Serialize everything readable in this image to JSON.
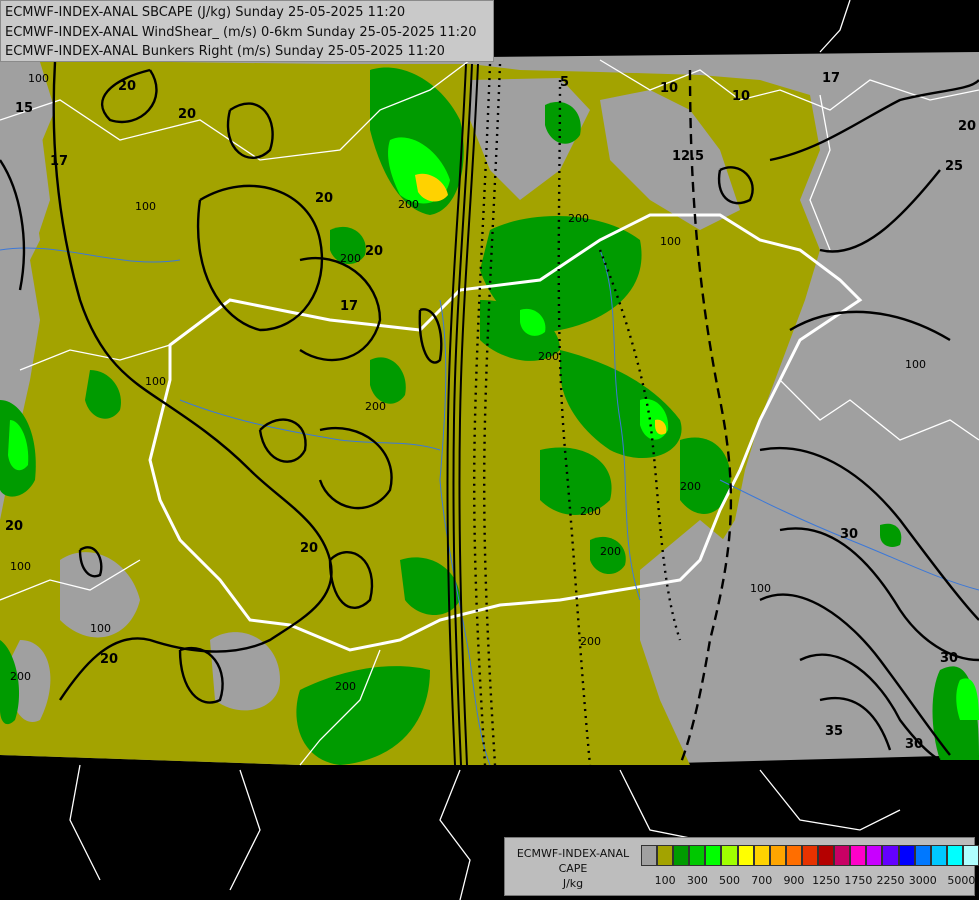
{
  "header": {
    "lines": [
      "ECMWF-INDEX-ANAL SBCAPE (J/kg) Sunday 25-05-2025 11:20",
      "ECMWF-INDEX-ANAL WindShear_ (m/s) 0-6km Sunday 25-05-2025 11:20",
      "ECMWF-INDEX-ANAL Bunkers Right (m/s) Sunday 25-05-2025 11:20"
    ]
  },
  "legend": {
    "title_line1": "ECMWF-INDEX-ANAL",
    "title_line2": "CAPE",
    "unit": "J/kg",
    "colors": [
      "#a0a0a0",
      "#a3a300",
      "#009b00",
      "#00c800",
      "#00ff00",
      "#a0ff00",
      "#ffff00",
      "#ffd200",
      "#ffa500",
      "#ff6e00",
      "#e63200",
      "#b40000",
      "#c80064",
      "#ff00c8",
      "#c800ff",
      "#6400ff",
      "#0000ff",
      "#0078ff",
      "#00c8ff",
      "#00ffff",
      "#afffff",
      "#ffffff"
    ],
    "tick_labels": [
      "100",
      "300",
      "500",
      "700",
      "900",
      "1250",
      "1750",
      "2250",
      "3000",
      "5000"
    ]
  },
  "map": {
    "contour_labels": [
      {
        "text": "20"
      },
      {
        "text": "20"
      },
      {
        "text": "20"
      },
      {
        "text": "17"
      },
      {
        "text": "20"
      },
      {
        "text": "20"
      },
      {
        "text": "17"
      },
      {
        "text": "15"
      },
      {
        "text": "17"
      },
      {
        "text": "20"
      },
      {
        "text": "25"
      },
      {
        "text": "30"
      },
      {
        "text": "30"
      },
      {
        "text": "35"
      },
      {
        "text": "30"
      },
      {
        "text": "20"
      },
      {
        "text": "20"
      },
      {
        "text": "10"
      },
      {
        "text": "12.5"
      },
      {
        "text": "10"
      },
      {
        "text": "5"
      },
      {
        "text": "100"
      },
      {
        "text": "100"
      },
      {
        "text": "200"
      },
      {
        "text": "200"
      },
      {
        "text": "200"
      },
      {
        "text": "100"
      },
      {
        "text": "100"
      },
      {
        "text": "200"
      },
      {
        "text": "200"
      },
      {
        "text": "200"
      },
      {
        "text": "200"
      },
      {
        "text": "200"
      },
      {
        "text": "100"
      },
      {
        "text": "100"
      },
      {
        "text": "200"
      },
      {
        "text": "100"
      },
      {
        "text": "200"
      },
      {
        "text": "100"
      },
      {
        "text": "200"
      }
    ]
  }
}
